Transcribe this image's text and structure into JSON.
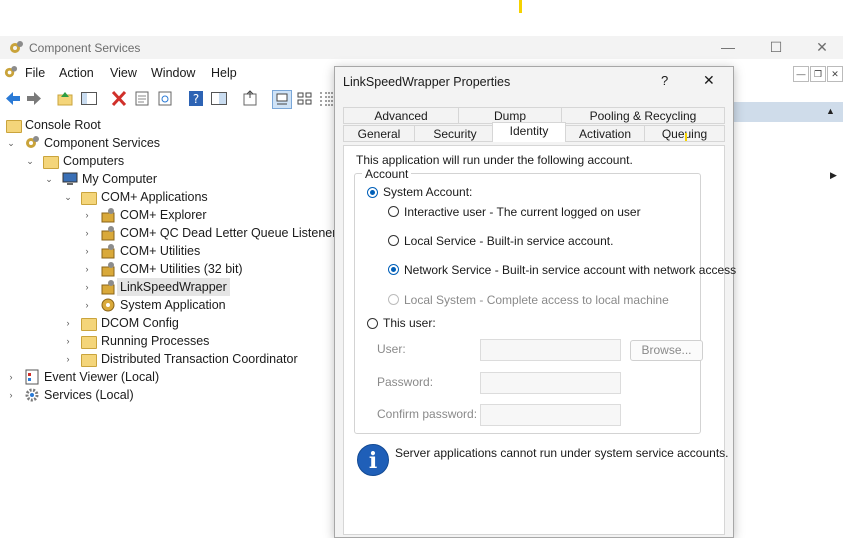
{
  "main": {
    "title": "Component Services",
    "menu": [
      "File",
      "Action",
      "View",
      "Window",
      "Help"
    ],
    "caption": {
      "minimize": "—",
      "maximize": "☐",
      "close": "✕"
    },
    "subcaption": {
      "minimize": "—",
      "restore": "❐",
      "close": "✕"
    }
  },
  "tree": {
    "console_root": "Console Root",
    "component_services": "Component Services",
    "computers": "Computers",
    "my_computer": "My Computer",
    "com_apps": "COM+ Applications",
    "apps": [
      "COM+ Explorer",
      "COM+ QC Dead Letter Queue Listener",
      "COM+ Utilities",
      "COM+ Utilities (32 bit)",
      "LinkSpeedWrapper",
      "System Application"
    ],
    "dcom": "DCOM Config",
    "running": "Running Processes",
    "dtc": "Distributed Transaction Coordinator",
    "event_viewer": "Event Viewer (Local)",
    "services": "Services (Local)"
  },
  "dialog": {
    "title": "LinkSpeedWrapper Properties",
    "help": "?",
    "close": "✕",
    "tabs_row1": [
      "Advanced",
      "Dump",
      "Pooling & Recycling"
    ],
    "tabs_row2": [
      "General",
      "Security",
      "Identity",
      "Activation",
      "Queuing"
    ],
    "intro": "This application will run under the following account.",
    "account_label": "Account",
    "system_account": "System Account:",
    "options": [
      "Interactive user - The current logged on user",
      "Local Service - Built-in service account.",
      "Network Service - Built-in service account with network access",
      "Local System - Complete access to local machine"
    ],
    "this_user": "This user:",
    "user_label": "User:",
    "password_label": "Password:",
    "confirm_label": "Confirm password:",
    "browse": "Browse...",
    "info": "Server applications cannot run under system service accounts.",
    "info_glyph": "i"
  },
  "colors": {
    "accent": "#005fb8",
    "highlight": "#f5d200"
  }
}
